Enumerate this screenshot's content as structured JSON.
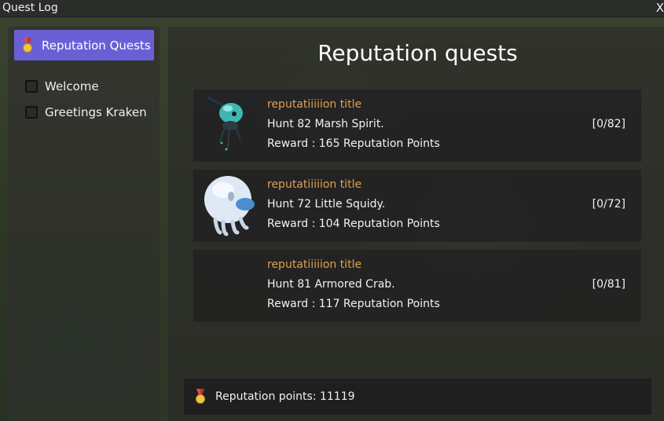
{
  "window": {
    "title": "Quest Log",
    "close_glyph": "X"
  },
  "sidebar": {
    "active_category": {
      "label": "Reputation Quests",
      "icon": "medal-icon"
    },
    "items": [
      {
        "label": "Welcome",
        "checked": false
      },
      {
        "label": "Greetings Kraken",
        "checked": false
      }
    ]
  },
  "main": {
    "heading": "Reputation quests",
    "quests": [
      {
        "title": "reputatiiiiion title",
        "objective": "Hunt 82 Marsh Spirit.",
        "reward": "Reward : 165 Reputation Points",
        "progress": "[0/82]",
        "portrait": "marsh-spirit-portrait"
      },
      {
        "title": "reputatiiiiion title",
        "objective": "Hunt 72 Little Squidy.",
        "reward": "Reward : 104 Reputation Points",
        "progress": "[0/72]",
        "portrait": "little-squidy-portrait"
      },
      {
        "title": "reputatiiiiion title",
        "objective": "Hunt 81 Armored Crab.",
        "reward": "Reward : 117 Reputation Points",
        "progress": "[0/81]",
        "portrait": ""
      }
    ]
  },
  "footer": {
    "label": "Reputation points: 11119",
    "icon": "medal-icon"
  },
  "colors": {
    "accent": "#6b5fd6",
    "quest_title": "#e2a04a",
    "panel": "#2c2c2a"
  }
}
